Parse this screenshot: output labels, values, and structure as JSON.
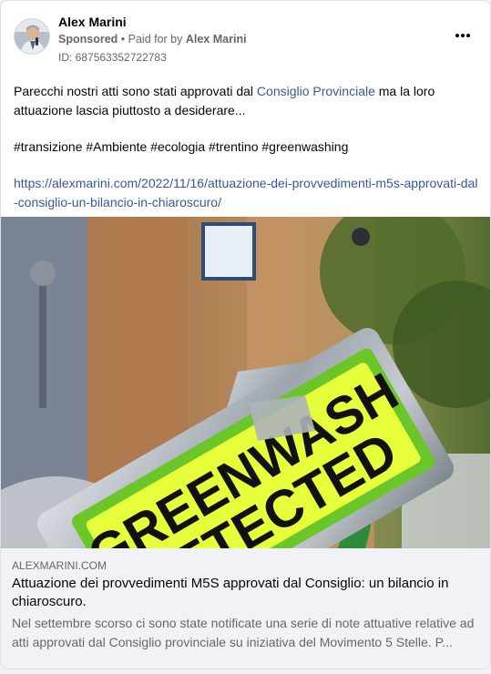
{
  "post": {
    "author": "Alex Marini",
    "sponsored_label": "Sponsored",
    "separator": " • ",
    "paid_for_prefix": "Paid for by ",
    "paid_for_name": "Alex Marini",
    "ad_id": "ID: 687563352722783",
    "more_icon": "more-horizontal-icon",
    "body": {
      "line1_pre": "Parecchi nostri atti sono stati approvati dal ",
      "line1_link": "Consiglio Provinciale",
      "line1_post": " ma la loro attuazione lascia piuttosto a desiderare...",
      "hashtags": "#transizione #Ambiente #ecologia #trentino #greenwashing",
      "url": "https://alexmarini.com/2022/11/16/attuazione-dei-provvedimenti-m5s-approvati-dal-consiglio-un-bilancio-in-chiaroscuro/"
    },
    "image": {
      "sign_text_line1": "GREENWASH",
      "sign_text_line2": "DETECTED"
    },
    "link_preview": {
      "domain": "ALEXMARINI.COM",
      "title": "Attuazione dei provvedimenti M5S approvati dal Consiglio: un bilancio in chiaroscuro.",
      "description": "Nel settembre scorso ci sono state notificate una serie di note attuative relative ad atti approvati dal Consiglio provinciale su iniziativa del Movimento 5 Stelle. P..."
    }
  }
}
